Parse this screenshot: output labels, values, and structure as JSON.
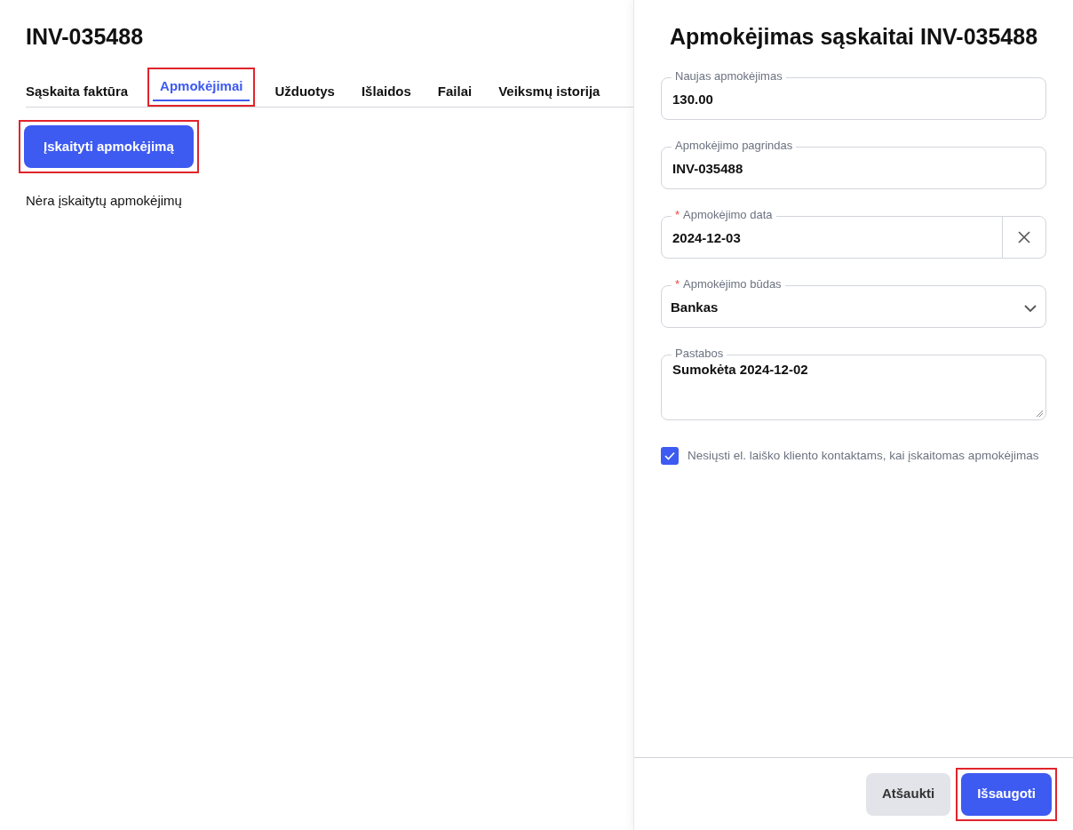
{
  "invoice": {
    "title": "INV-035488"
  },
  "tabs": [
    {
      "label": "Sąskaita faktūra",
      "selected": false,
      "highlighted": false
    },
    {
      "label": "Apmokėjimai",
      "selected": true,
      "highlighted": true
    },
    {
      "label": "Užduotys",
      "selected": false,
      "highlighted": false
    },
    {
      "label": "Išlaidos",
      "selected": false,
      "highlighted": false
    },
    {
      "label": "Failai",
      "selected": false,
      "highlighted": false
    },
    {
      "label": "Veiksmų istorija",
      "selected": false,
      "highlighted": false
    }
  ],
  "add_button": {
    "label": "Įskaityti apmokėjimą",
    "highlighted": true
  },
  "empty_message": "Nėra įskaitytų apmokėjimų",
  "panel": {
    "title": "Apmokėjimas sąskaitai INV-035488",
    "required_marker": "*",
    "fields": [
      {
        "kind": "text",
        "label": "Naujas apmokėjimas",
        "value": "130.00",
        "required": false
      },
      {
        "kind": "text",
        "label": "Apmokėjimo pagrindas",
        "value": "INV-035488",
        "required": false
      },
      {
        "kind": "date",
        "label": "Apmokėjimo data",
        "value": "2024-12-03",
        "required": true
      },
      {
        "kind": "select",
        "label": "Apmokėjimo būdas",
        "value": "Bankas",
        "required": true
      },
      {
        "kind": "textarea",
        "label": "Pastabos",
        "value": "Sumokėta 2024-12-02",
        "required": false
      }
    ],
    "checkbox": {
      "label": "Nesiųsti el. laiško kliento kontaktams, kai įskaitomas apmokėjimas",
      "checked": true
    },
    "buttons": [
      {
        "kind": "secondary",
        "label": "Atšaukti",
        "highlighted": false
      },
      {
        "kind": "primary",
        "label": "Išsaugoti",
        "highlighted": true
      }
    ]
  }
}
